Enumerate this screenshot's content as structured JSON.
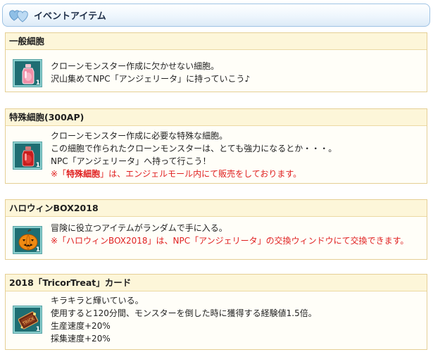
{
  "header": {
    "title": "イベントアイテム"
  },
  "items": [
    {
      "name": "一般細胞",
      "icon": "pink-vial-icon",
      "quantity": "1",
      "lines": [
        "クローンモンスター作成に欠かせない細胞。",
        "沢山集めてNPC「アンジェリータ」に持っていこう♪"
      ]
    },
    {
      "name": "特殊細胞(300AP)",
      "icon": "red-vial-icon",
      "quantity": "1",
      "lines": [
        "クローンモンスター作成に必要な特殊な細胞。",
        "この細胞で作られたクローンモンスターは、とても強力になるとか・・・。",
        "NPC「アンジェリータ」へ持って行こう！"
      ],
      "note": {
        "prefix": "※「",
        "bold": "特殊細胞",
        "suffix": "」は、エンジェルモール内にて販売をしております。"
      }
    },
    {
      "name": "ハロウィンBOX2018",
      "icon": "pumpkin-box-icon",
      "quantity": "1",
      "lines": [
        "冒険に役立つアイテムがランダムで手に入る。"
      ],
      "note_text": "※「ハロウィンBOX2018」は、NPC「アンジェリータ」の交換ウィンドウにて交換できます。"
    },
    {
      "name": "2018「TricorTreat」カード",
      "icon": "trick-card-icon",
      "quantity": "1",
      "lines": [
        "キラキラと輝いている。",
        "使用すると120分間、モンスターを倒した時に獲得する経験値1.5倍。",
        "生産速度+20%",
        "採集速度+20%"
      ]
    }
  ],
  "colors": {
    "note_red": "#e02020",
    "header_border": "#9fc3e4",
    "card_border": "#e5cf95",
    "icon_bg": "#1f6e73"
  }
}
